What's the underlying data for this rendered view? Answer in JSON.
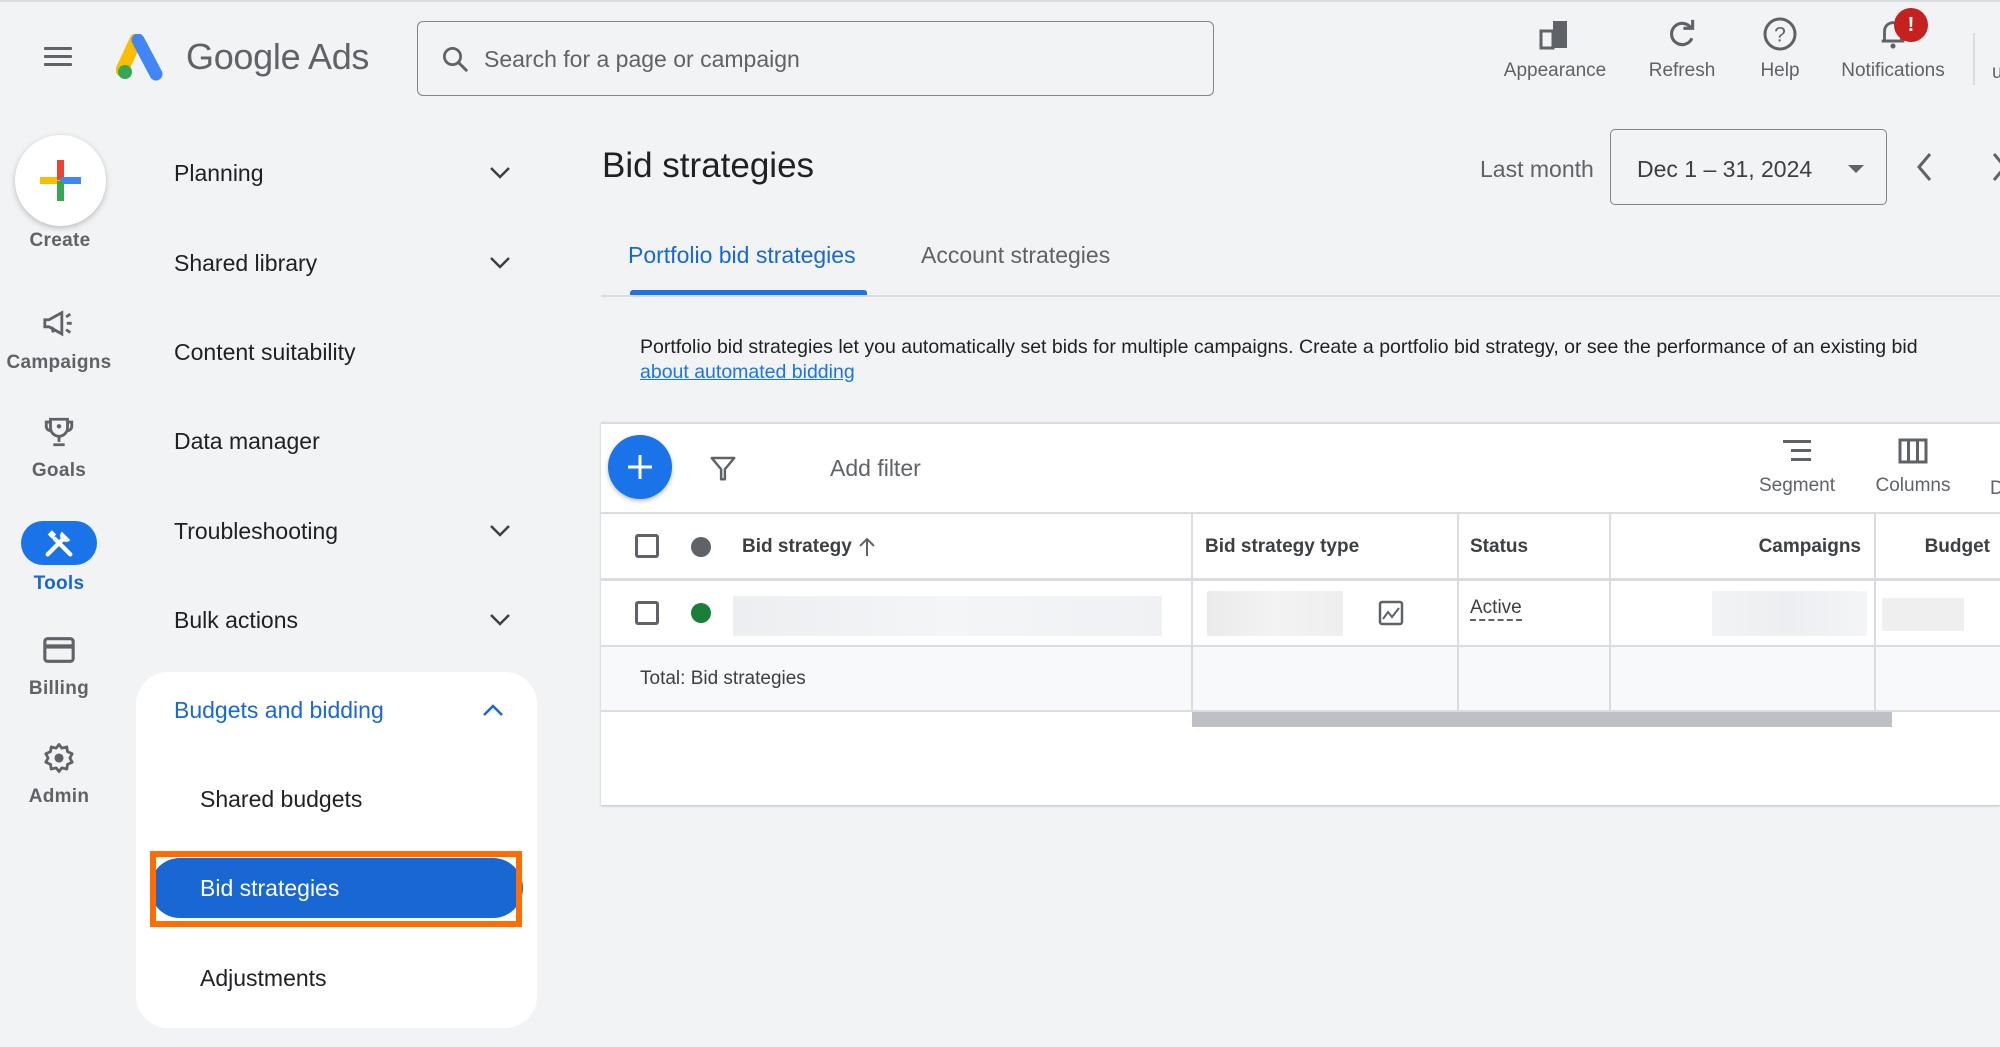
{
  "app": {
    "brand": "Google Ads",
    "search_placeholder": "Search for a page or campaign"
  },
  "header_actions": [
    {
      "label": "Appearance",
      "icon": "appearance-icon"
    },
    {
      "label": "Refresh",
      "icon": "refresh-icon"
    },
    {
      "label": "Help",
      "icon": "help-icon"
    },
    {
      "label": "Notifications",
      "icon": "bell-icon",
      "badge": "!"
    }
  ],
  "header_cut_label": "u",
  "rail": {
    "create_label": "Create",
    "items": [
      {
        "label": "Campaigns",
        "icon": "megaphone-icon"
      },
      {
        "label": "Goals",
        "icon": "trophy-icon"
      },
      {
        "label": "Tools",
        "icon": "tools-icon",
        "active": true
      },
      {
        "label": "Billing",
        "icon": "credit-card-icon"
      },
      {
        "label": "Admin",
        "icon": "gear-icon"
      }
    ]
  },
  "nav": {
    "items": [
      {
        "label": "Planning",
        "expandable": true
      },
      {
        "label": "Shared library",
        "expandable": true
      },
      {
        "label": "Content suitability",
        "expandable": false
      },
      {
        "label": "Data manager",
        "expandable": false
      },
      {
        "label": "Troubleshooting",
        "expandable": true
      },
      {
        "label": "Bulk actions",
        "expandable": true
      }
    ],
    "expanded_section": {
      "label": "Budgets and bidding",
      "children": [
        {
          "label": "Shared budgets"
        },
        {
          "label": "Bid strategies",
          "selected": true
        },
        {
          "label": "Adjustments"
        }
      ]
    }
  },
  "page": {
    "title": "Bid strategies",
    "date_range_label": "Last month",
    "date_range_value": "Dec 1 – 31, 2024",
    "tabs": [
      {
        "label": "Portfolio bid strategies",
        "active": true
      },
      {
        "label": "Account strategies",
        "active": false
      }
    ],
    "description": "Portfolio bid strategies let you automatically set bids for multiple campaigns. Create a portfolio bid strategy, or see the performance of an existing bid",
    "description_link": "about automated bidding"
  },
  "table": {
    "toolbar": {
      "add_filter": "Add filter",
      "segment": "Segment",
      "columns": "Columns",
      "cut_label": "D"
    },
    "columns": [
      "Bid strategy",
      "Bid strategy type",
      "Status",
      "Campaigns",
      "Budget"
    ],
    "sort": {
      "column": "Bid strategy",
      "direction": "ascending"
    },
    "rows": [
      {
        "status_dot": "#188038",
        "bid_strategy": "",
        "bid_strategy_type": "",
        "status": "Active",
        "campaigns": "",
        "budget": ""
      }
    ],
    "total_label": "Total: Bid strategies"
  },
  "colors": {
    "accent": "#1a73e8",
    "selected_nav": "#1967d2",
    "annotation_box": "#ff6d00",
    "status_enabled": "#188038",
    "notification_badge": "#c5221f"
  }
}
